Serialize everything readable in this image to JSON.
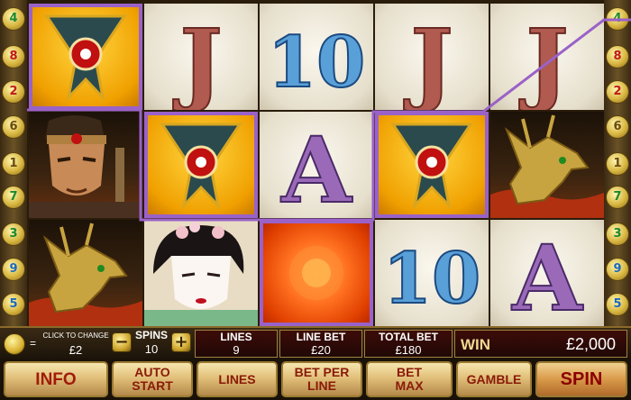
{
  "left_paylines": [
    {
      "num": "4",
      "color": "#1a8a30"
    },
    {
      "num": "8",
      "color": "#c01a1a"
    },
    {
      "num": "2",
      "color": "#c01a1a"
    },
    {
      "num": "6",
      "color": "#6a4a10"
    },
    {
      "num": "1",
      "color": "#6a4a10"
    },
    {
      "num": "7",
      "color": "#1a8a30"
    },
    {
      "num": "3",
      "color": "#1a8a30"
    },
    {
      "num": "9",
      "color": "#1a6ac0"
    },
    {
      "num": "5",
      "color": "#1a6ac0"
    }
  ],
  "right_paylines": [
    {
      "num": "4",
      "color": "#1a8a30"
    },
    {
      "num": "8",
      "color": "#c01a1a"
    },
    {
      "num": "2",
      "color": "#c01a1a"
    },
    {
      "num": "6",
      "color": "#6a4a10"
    },
    {
      "num": "1",
      "color": "#6a4a10"
    },
    {
      "num": "7",
      "color": "#1a8a30"
    },
    {
      "num": "3",
      "color": "#1a8a30"
    },
    {
      "num": "9",
      "color": "#1a6ac0"
    },
    {
      "num": "5",
      "color": "#1a6ac0"
    }
  ],
  "reels": [
    [
      "shuriken",
      "samurai",
      "dragon"
    ],
    [
      "letter-j",
      "shuriken",
      "geisha"
    ],
    [
      "number-10",
      "letter-a",
      "sun"
    ],
    [
      "letter-j",
      "shuriken",
      "number-10"
    ],
    [
      "letter-j",
      "dragon",
      "letter-a"
    ]
  ],
  "reel_glyphs": {
    "letter-j": "J",
    "letter-a": "A",
    "number-10": "10"
  },
  "highlight_color": "#9a62c8",
  "controls": {
    "coin": {
      "label": "CLICK TO CHANGE",
      "equals": "=",
      "value": "£2"
    },
    "spins": {
      "label": "SPINS",
      "value": "10",
      "minus": "−",
      "plus": "+"
    },
    "lines": {
      "label": "LINES",
      "value": "9"
    },
    "line_bet": {
      "label": "LINE BET",
      "value": "£20"
    },
    "total_bet": {
      "label": "TOTAL BET",
      "value": "£180"
    },
    "win": {
      "label": "WIN",
      "value": "£2,000"
    }
  },
  "buttons": {
    "info": "INFO",
    "auto_start": "AUTO START",
    "lines": "LINES",
    "bet_per_line": "BET PER LINE",
    "bet_max": "BET MAX",
    "gamble": "GAMBLE",
    "spin": "SPIN"
  }
}
